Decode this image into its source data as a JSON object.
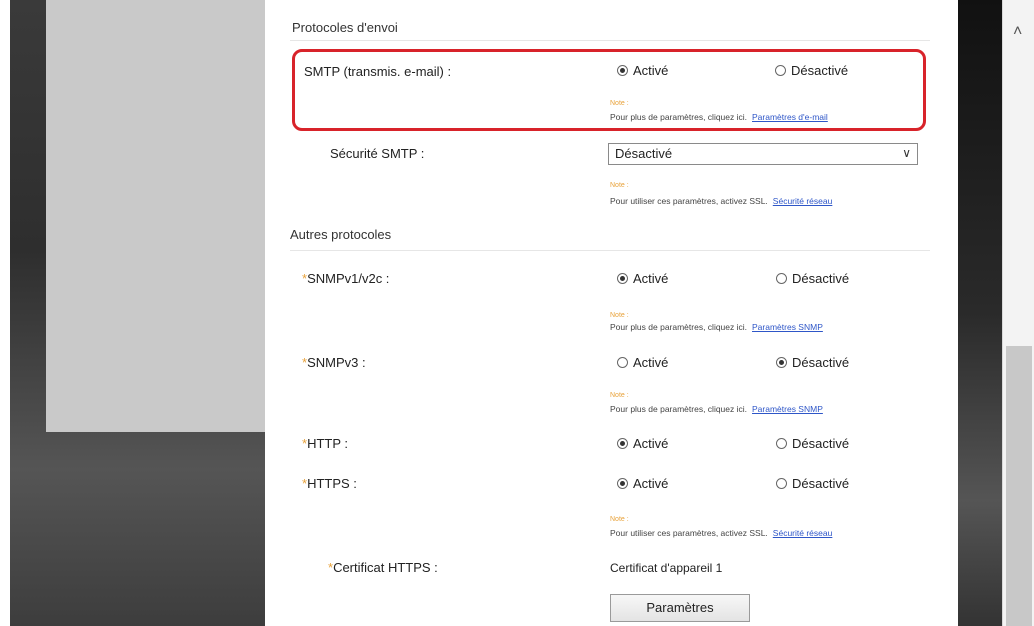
{
  "sections": {
    "sending_title": "Protocoles d'envoi",
    "other_title": "Autres protocoles"
  },
  "radio_labels": {
    "on": "Activé",
    "off": "Désactivé"
  },
  "note_label": "Note :",
  "rows": {
    "smtp": {
      "label": "SMTP (transmis. e-mail) :",
      "selected": "on",
      "note_text": "Pour plus de paramètres, cliquez ici.",
      "note_link": "Paramètres d'e-mail"
    },
    "smtp_security": {
      "label": "Sécurité SMTP :",
      "value": "Désactivé",
      "note_text": "Pour utiliser ces paramètres, activez SSL.",
      "note_link": "Sécurité réseau"
    },
    "snmpv1": {
      "label": "SNMPv1/v2c :",
      "selected": "on",
      "note_text": "Pour plus de paramètres, cliquez ici.",
      "note_link": "Paramètres SNMP"
    },
    "snmpv3": {
      "label": "SNMPv3 :",
      "selected": "off",
      "note_text": "Pour plus de paramètres, cliquez ici.",
      "note_link": "Paramètres SNMP"
    },
    "http": {
      "label": "HTTP :",
      "selected": "on"
    },
    "https": {
      "label": "HTTPS :",
      "selected": "on",
      "note_text": "Pour utiliser ces paramètres, activez SSL.",
      "note_link": "Sécurité réseau"
    },
    "https_cert": {
      "label": "Certificat HTTPS :",
      "value": "Certificat d'appareil 1",
      "button": "Paramètres"
    }
  },
  "icons": {
    "scroll_up": "chevron-up-icon",
    "select_arrow": "chevron-down-icon"
  },
  "colors": {
    "highlight": "#d8232a",
    "required": "#e8a23a",
    "link": "#2e56c8"
  }
}
